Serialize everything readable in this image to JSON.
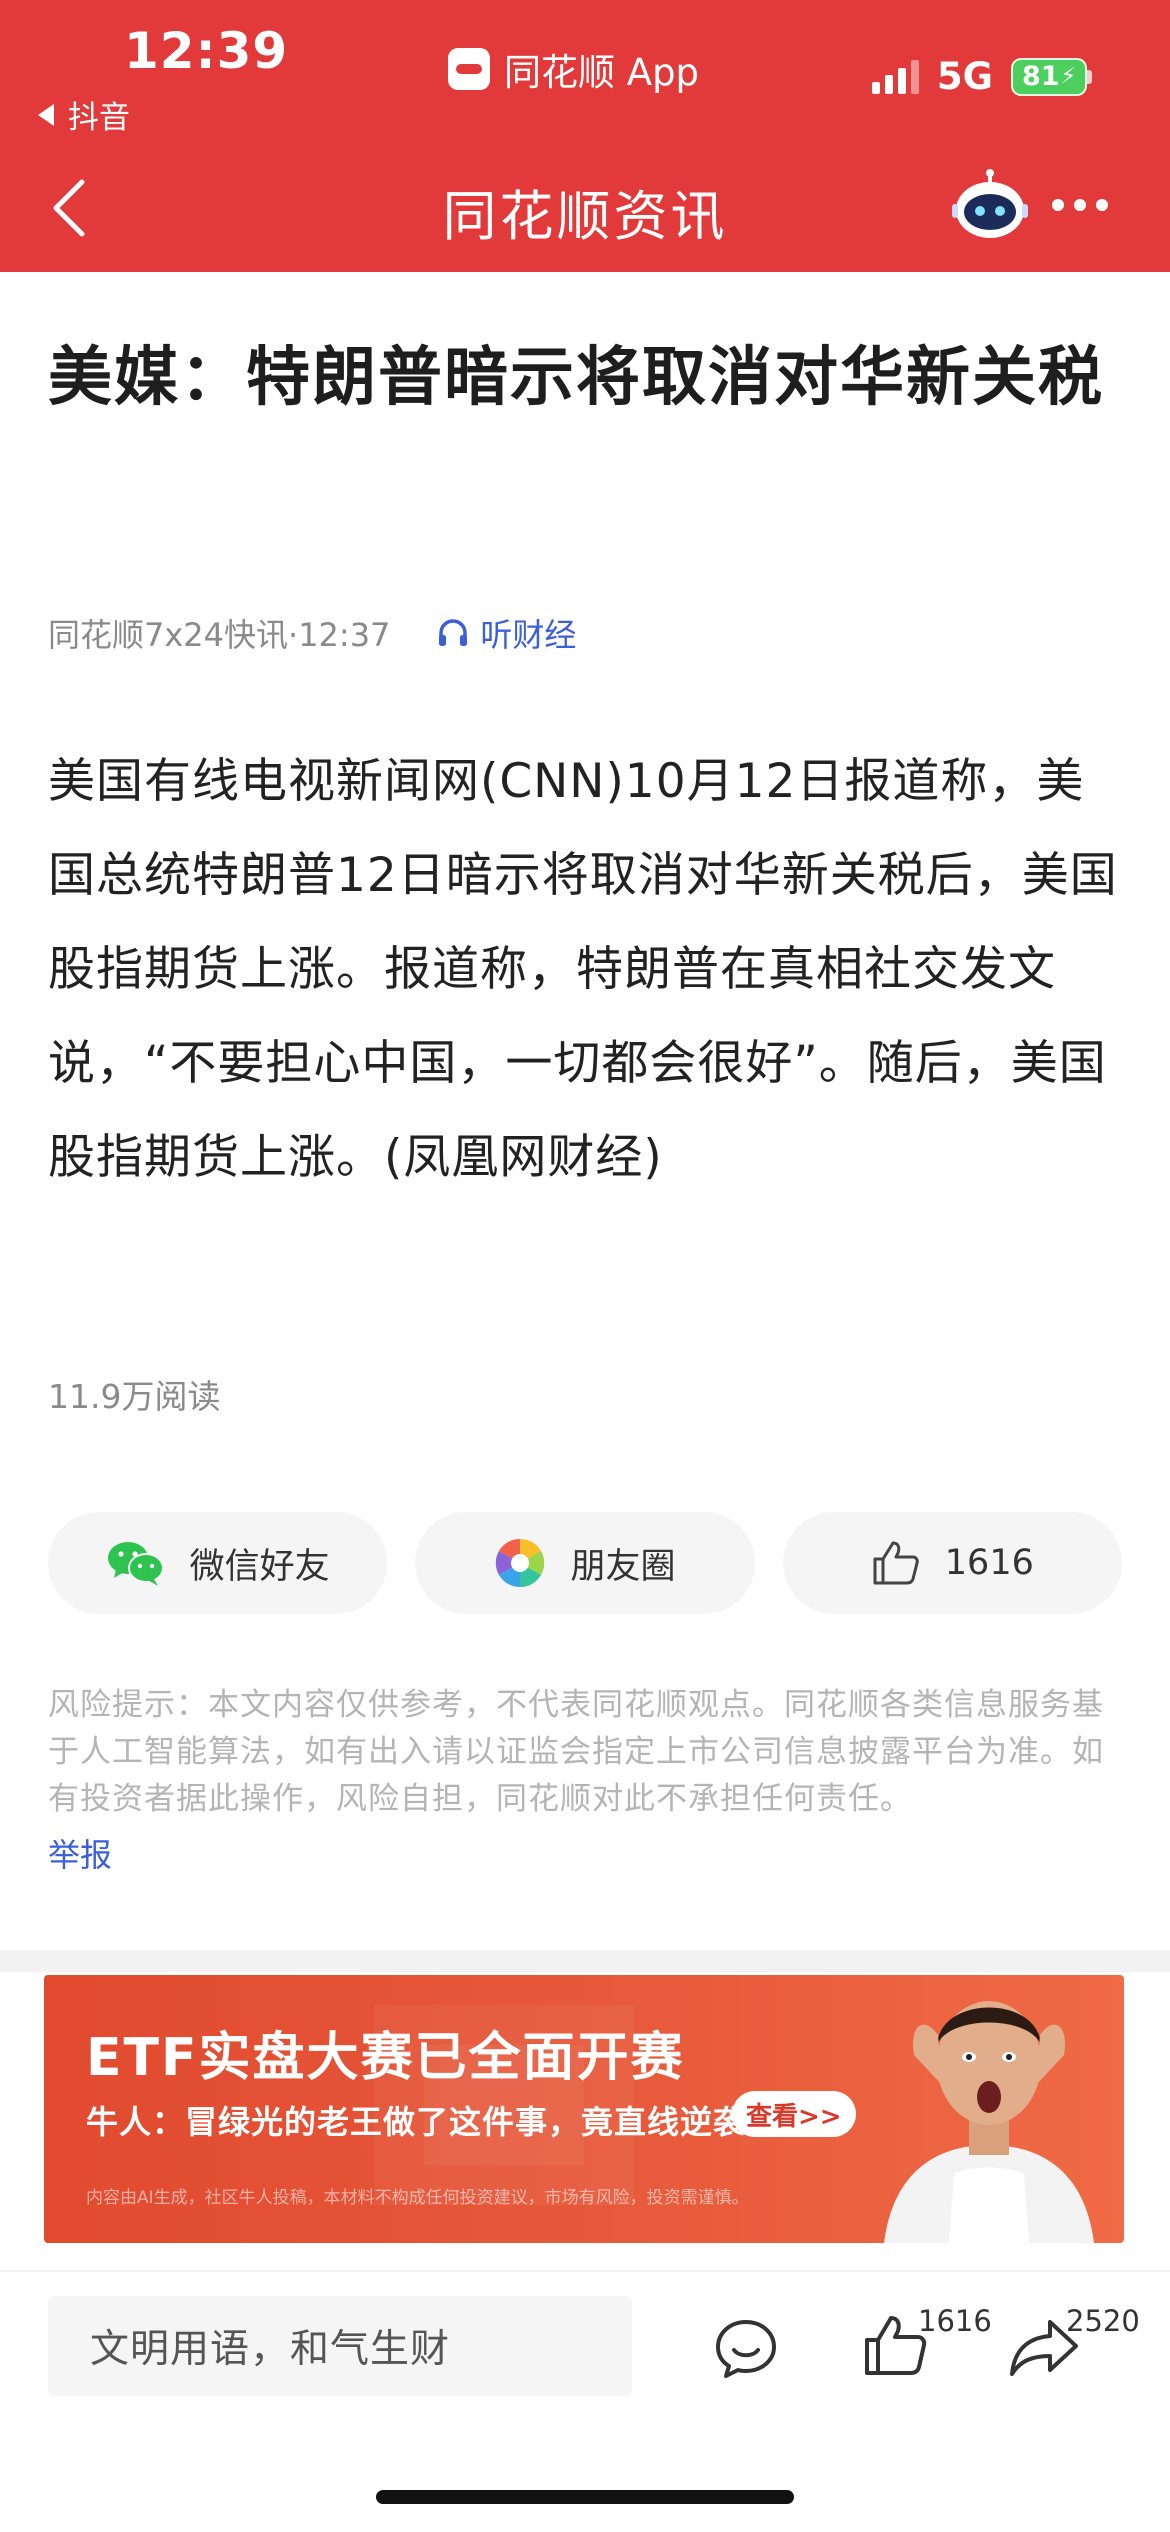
{
  "status_bar": {
    "time": "12:39",
    "back_app": "抖音",
    "center_app": "同花顺 App",
    "network": "5G",
    "battery": "81"
  },
  "nav": {
    "title": "同花顺资讯"
  },
  "article": {
    "headline": "美媒：特朗普暗示将取消对华新关税",
    "source_time": "同花顺7x24快讯·12:37",
    "listen_label": "听财经",
    "body": "美国有线电视新闻网(CNN)10月12日报道称，美国总统特朗普12日暗示将取消对华新关税后，美国股指期货上涨。报道称，特朗普在真相社交发文说，“不要担心中国，一切都会很好”。随后，美国股指期货上涨。(凤凰网财经)",
    "reads": "11.9万阅读"
  },
  "share": {
    "wechat_label": "微信好友",
    "moments_label": "朋友圈",
    "like_count": "1616"
  },
  "disclaimer": {
    "text": "风险提示：本文内容仅供参考，不代表同花顺观点。同花顺各类信息服务基于人工智能算法，如有出入请以证监会指定上市公司信息披露平台为准。如有投资者据此操作，风险自担，同花顺对此不承担任何责任。",
    "report_label": "举报"
  },
  "ad": {
    "title": "ETF实盘大赛已全面开赛",
    "subtitle": "牛人：冒绿光的老王做了这件事，竟直线逆袭",
    "cta": "查看>>",
    "fineprint": "内容由AI生成，社区牛人投稿，本材料不构成任何投资建议，市场有风险，投资需谨慎。"
  },
  "bottom_bar": {
    "comment_placeholder": "文明用语，和气生财",
    "like_count": "1616",
    "share_count": "2520"
  },
  "colors": {
    "header_red": "#e23a3a",
    "link_blue": "#3a5fd8",
    "battery_green": "#4ccf5c"
  },
  "icons": {
    "nav_back": "chevron-left-icon",
    "assistant": "robot-icon",
    "more": "more-dots-icon",
    "listen": "headphones-icon",
    "wechat": "wechat-icon",
    "moments": "moments-camera-icon",
    "like": "thumbs-up-icon",
    "comment": "comment-icon",
    "share": "share-arrow-icon"
  }
}
